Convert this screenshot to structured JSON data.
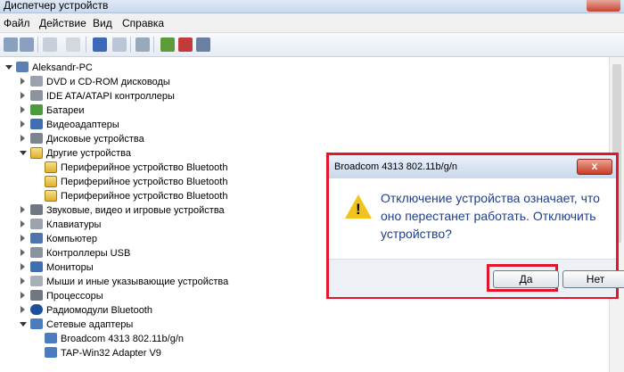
{
  "window": {
    "title": "Диспетчер устройств"
  },
  "menu": {
    "file": "Файл",
    "action": "Действие",
    "view": "Вид",
    "help": "Справка"
  },
  "tree": {
    "root": "Aleksandr-PC",
    "items": [
      "DVD и CD-ROM дисководы",
      "IDE ATA/ATAPI контроллеры",
      "Батареи",
      "Видеоадаптеры",
      "Дисковые устройства",
      "Другие устройства",
      "Периферийное устройство Bluetooth",
      "Периферийное устройство Bluetooth",
      "Периферийное устройство Bluetooth",
      "Звуковые, видео и игровые устройства",
      "Клавиатуры",
      "Компьютер",
      "Контроллеры USB",
      "Мониторы",
      "Мыши и иные указывающие устройства",
      "Процессоры",
      "Радиомодули Bluetooth",
      "Сетевые адаптеры",
      "Broadcom 4313 802.11b/g/n",
      "TAP-Win32 Adapter V9"
    ]
  },
  "dialog": {
    "title": "Broadcom 4313 802.11b/g/n",
    "close_label": "x",
    "message": "Отключение устройства означает, что оно перестанет работать. Отключить устройство?",
    "yes_label": "Да",
    "no_label": "Нет"
  },
  "colors": {
    "highlight": "#e3152b",
    "message_text": "#1f3e8c"
  }
}
